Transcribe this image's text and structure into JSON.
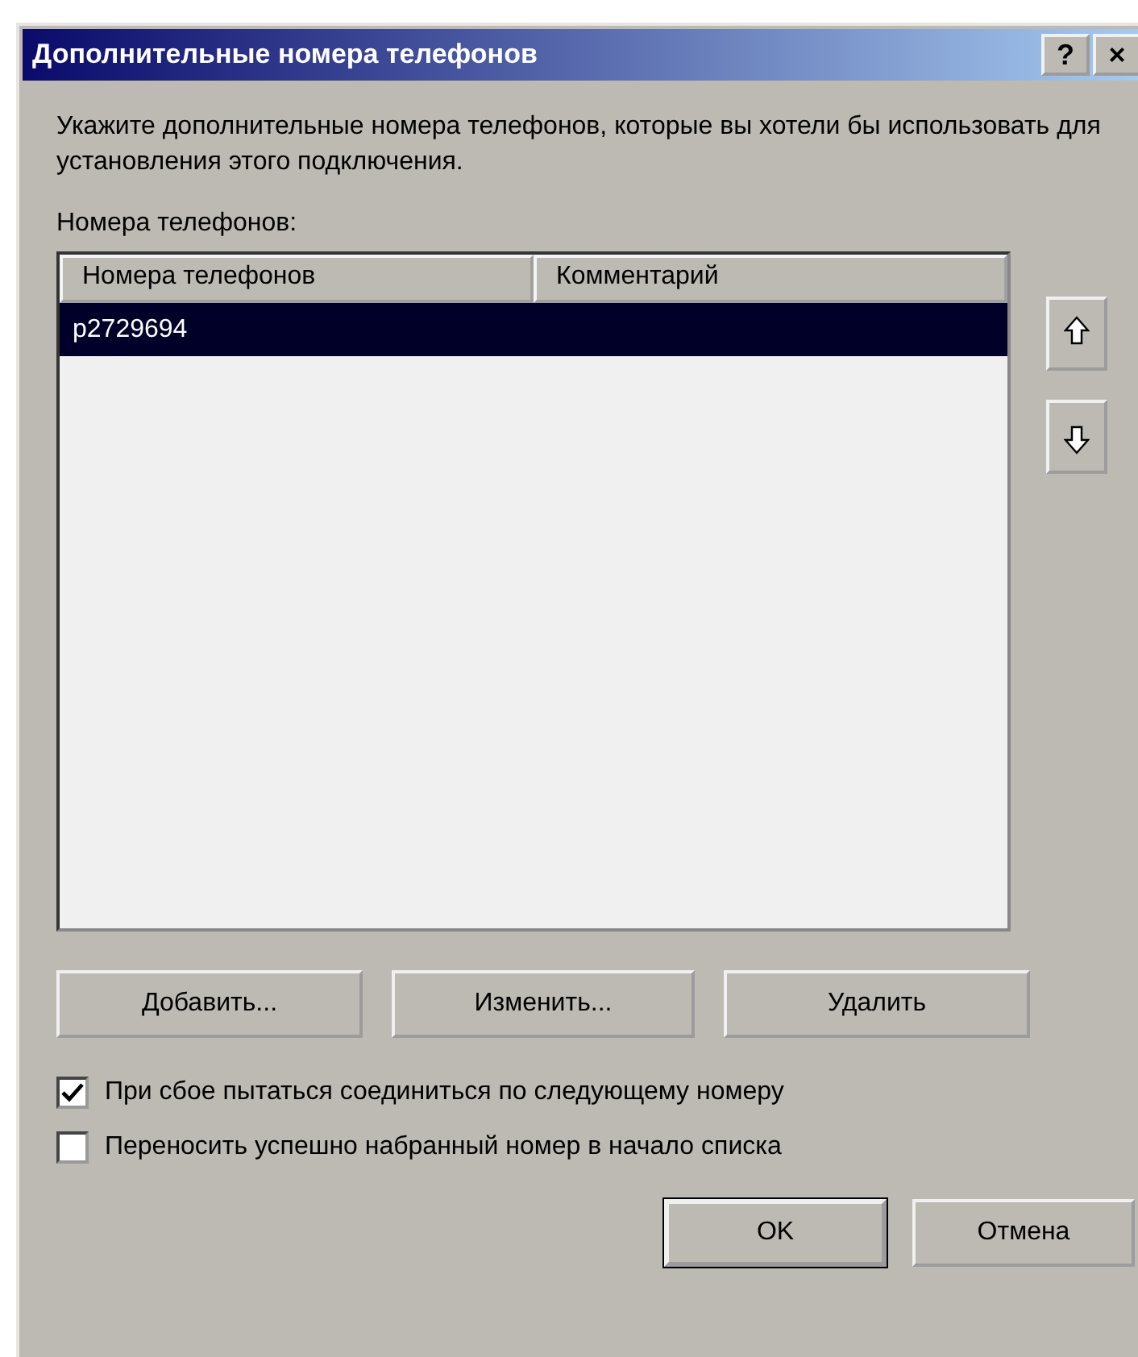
{
  "window": {
    "title": "Дополнительные номера телефонов",
    "title_buttons": [
      "?",
      "×"
    ]
  },
  "description": "Укажите дополнительные номера телефонов, которые вы хотели бы использовать для установления этого подключения.",
  "list_label": "Номера телефонов:",
  "table": {
    "columns": [
      "Номера телефонов",
      "Комментарий"
    ],
    "rows": [
      {
        "cells": [
          "p2729694",
          ""
        ],
        "selected": true
      }
    ]
  },
  "buttons": [
    "Добавить...",
    "Изменить...",
    "Удалить"
  ],
  "checkboxes": [
    {
      "label": "При сбое пытаться соединиться по следующему номеру",
      "checked": true
    },
    {
      "label": "Переносить успешно набранный номер в начало списка",
      "checked": false
    }
  ],
  "dialog_buttons": [
    {
      "label": "OK",
      "default": true
    },
    {
      "label": "Отмена",
      "default": false
    }
  ]
}
